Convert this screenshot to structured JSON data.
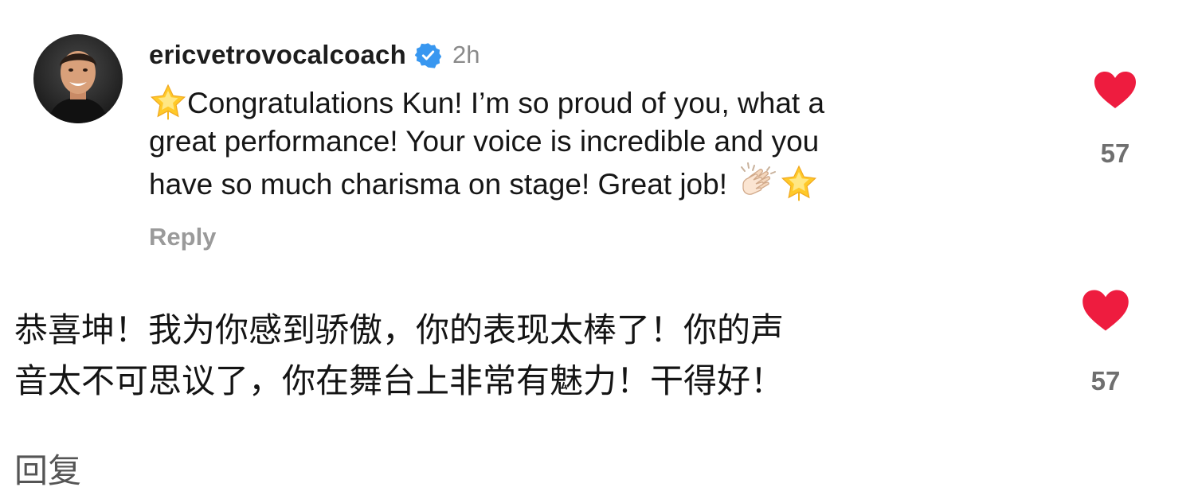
{
  "comment": {
    "username": "ericvetrovocalcoach",
    "verified_icon": "verified-badge-icon",
    "timestamp": "2h",
    "lines": [
      "Congratulations Kun! I’m so proud of you, what a",
      "great performance! Your voice is incredible and you",
      "have so much charisma on stage! Great job!"
    ],
    "emoji_start": "star-emoji",
    "emoji_end": [
      "clapping-hands-emoji",
      "star-emoji"
    ],
    "reply_label": "Reply",
    "likes": "57"
  },
  "translation": {
    "lines": [
      "恭喜坤！我为你感到骄傲，你的表现太棒了！你的声",
      "音太不可思议了，你在舞台上非常有魅力！干得好！"
    ],
    "likes": "57",
    "reply_label": "回复"
  },
  "colors": {
    "heart": "#ee1c3f",
    "verified": "#3897f0",
    "muted": "#8a8a8a"
  }
}
